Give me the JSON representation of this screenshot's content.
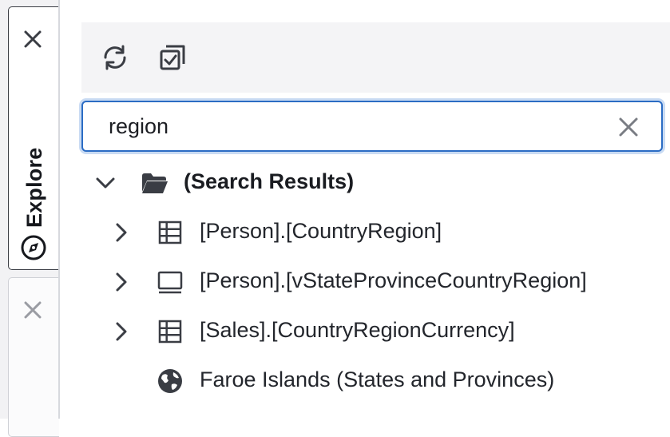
{
  "sidebar": {
    "tabs": [
      {
        "label": "Explore",
        "icon": "compass-icon",
        "active": true
      },
      {
        "label": "",
        "active": false
      }
    ]
  },
  "toolbar": {
    "buttons": [
      {
        "icon": "refresh-icon"
      },
      {
        "icon": "select-all-icon"
      }
    ]
  },
  "search": {
    "value": "region"
  },
  "tree": {
    "root": {
      "label": "(Search Results)",
      "icon": "folder-open-icon",
      "expanded": true
    },
    "items": [
      {
        "label": "[Person].[CountryRegion]",
        "icon": "table-icon",
        "expandable": true
      },
      {
        "label": "[Person].[vStateProvinceCountryRegion]",
        "icon": "view-icon",
        "expandable": true
      },
      {
        "label": "[Sales].[CountryRegionCurrency]",
        "icon": "table-icon",
        "expandable": true
      },
      {
        "label": "Faroe Islands (States and Provinces)",
        "icon": "globe-icon",
        "expandable": false
      }
    ]
  },
  "colors": {
    "accent": "#2b6cc4",
    "icon": "#3a3d44",
    "text": "#23262c"
  }
}
